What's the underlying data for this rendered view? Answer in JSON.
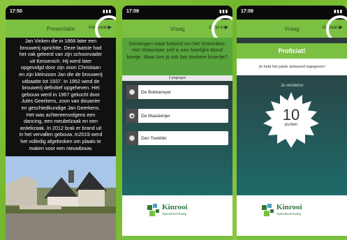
{
  "status": {
    "time1": "17:50",
    "time2": "17:09",
    "time3": "17:09"
  },
  "screen1": {
    "title": "Presentatie",
    "next": "Volgende",
    "lines": [
      "Jan Vinken die in 1866 later een",
      "brouwerij oprichtte. Deze laatste had",
      "het vak geleerd van zijn schoonvader",
      "uit Kessenich. Hij werd later",
      "opgevolgd door zijn zoon Christiaan",
      "en zijn kleinzoon Jan die de brouwerij",
      "uitbaatte tot 1937. In 1952 werd de",
      "brouwerij definitief opgeheven. Het",
      "gebouw werd in 1967 gekocht door",
      "Jules Geerkens, zoon van douanier",
      "en geschiedkundige Jan Geerkens.",
      "Het was achtereenvolgens een",
      "dancing, een meubelzaak en een",
      "antiekzaak. In 2012 brak er brand uit",
      "in het vervallen gebouw. In2019 werd",
      "het volledig afgebroken om plaats te",
      "maken voor een nieuwbouw."
    ]
  },
  "screen2": {
    "title": "Vraag",
    "submit": "Zend in",
    "question": "Geistingen staat bekend om het Vinkenbier. Het Vinkenbier zelf is een heerlijke blond biertje. Maar ken jij ook het sterkere broertje?",
    "attempts": "2 pogingen",
    "options": [
      "De Bokkereyer",
      "De Maaslenjer",
      "Den Toetélèr"
    ],
    "selected_index": 1
  },
  "screen3": {
    "title": "Vraag",
    "done": "Gedaan",
    "banner": "Proficiat!",
    "message": "Je hebt het juiste antwoord ingegeven!",
    "earned_label": "Je verdienst",
    "points": "10",
    "points_unit": "punten"
  },
  "logo": {
    "name": "Kinrooi",
    "tagline": "Opendend Rustig"
  },
  "icons": {
    "arrow": "arrow-right-icon",
    "radio": "radio-icon",
    "logo": "kinrooi-logo-icon"
  },
  "colors": {
    "green": "#7cc043",
    "dark_green": "#56a43b",
    "teal": "#1f6a6a"
  }
}
